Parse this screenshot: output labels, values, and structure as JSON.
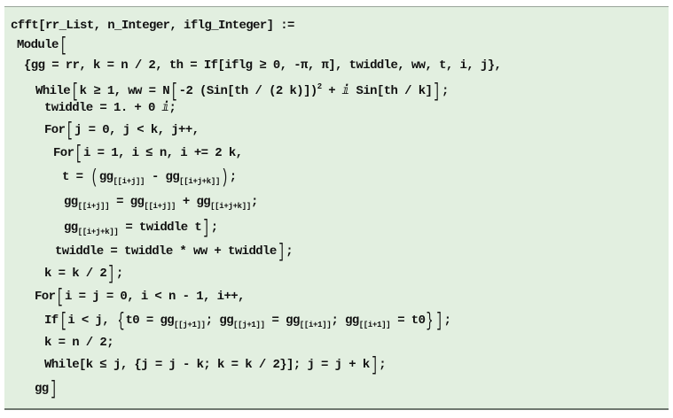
{
  "cell": {
    "background": "#e2efe0",
    "lines": [
      {
        "indent": 12,
        "segs": [
          {
            "t": "cfft[rr_List, n_Integer, iflg_Integer] :="
          }
        ]
      },
      {
        "indent": 19,
        "segs": [
          {
            "t": "Module"
          },
          {
            "t": "[",
            "k": "bb"
          }
        ]
      },
      {
        "indent": 27,
        "segs": [
          {
            "t": "{gg = rr, k = n / 2, th = If[iflg ≥ 0, -π, π], twiddle, ww, t, i, j},"
          }
        ]
      },
      {
        "indent": 40,
        "segs": [
          {
            "t": "While"
          },
          {
            "t": "[",
            "k": "bb"
          },
          {
            "t": "k ≥ 1, ww = N"
          },
          {
            "t": "[",
            "k": "bb"
          },
          {
            "t": "-2 (Sin[th / (2 k)])"
          },
          {
            "t": "2",
            "k": "sup"
          },
          {
            "t": " + ⅈ Sin[th / k]"
          },
          {
            "t": "]",
            "k": "bb"
          },
          {
            "t": ";"
          }
        ]
      },
      {
        "indent": 50,
        "segs": [
          {
            "t": "twiddle = 1. + 0 ⅈ;"
          }
        ]
      },
      {
        "indent": 50,
        "segs": [
          {
            "t": "For"
          },
          {
            "t": "[",
            "k": "bb"
          },
          {
            "t": "j = 0, j < k, j++,"
          }
        ]
      },
      {
        "indent": 60,
        "segs": [
          {
            "t": "For"
          },
          {
            "t": "[",
            "k": "bb"
          },
          {
            "t": "i = 1, i ≤ n, i += 2 k,"
          }
        ]
      },
      {
        "indent": 70,
        "segs": [
          {
            "t": "t = "
          },
          {
            "t": "(",
            "k": "bb"
          },
          {
            "t": "gg"
          },
          {
            "t": "[[i+j]]",
            "k": "sub"
          },
          {
            "t": " - gg"
          },
          {
            "t": "[[i+j+k]]",
            "k": "sub"
          },
          {
            "t": ")",
            "k": "bb"
          },
          {
            "t": ";"
          }
        ]
      },
      {
        "indent": 72,
        "segs": [
          {
            "t": "gg"
          },
          {
            "t": "[[i+j]]",
            "k": "sub"
          },
          {
            "t": " = gg"
          },
          {
            "t": "[[i+j]]",
            "k": "sub"
          },
          {
            "t": " + gg"
          },
          {
            "t": "[[i+j+k]]",
            "k": "sub"
          },
          {
            "t": ";"
          }
        ]
      },
      {
        "indent": 72,
        "segs": [
          {
            "t": "gg"
          },
          {
            "t": "[[i+j+k]]",
            "k": "sub"
          },
          {
            "t": " = twiddle t"
          },
          {
            "t": "]",
            "k": "bb"
          },
          {
            "t": ";"
          }
        ]
      },
      {
        "indent": 62,
        "segs": [
          {
            "t": "twiddle = twiddle * ww + twiddle"
          },
          {
            "t": "]",
            "k": "bb"
          },
          {
            "t": ";"
          }
        ]
      },
      {
        "indent": 50,
        "segs": [
          {
            "t": "k = k / 2"
          },
          {
            "t": "]",
            "k": "bb"
          },
          {
            "t": ";"
          }
        ]
      },
      {
        "indent": 39,
        "segs": [
          {
            "t": "For"
          },
          {
            "t": "[",
            "k": "bb"
          },
          {
            "t": "i = j = 0, i < n - 1, i++,"
          }
        ]
      },
      {
        "indent": 50,
        "segs": [
          {
            "t": "If"
          },
          {
            "t": "[",
            "k": "bb"
          },
          {
            "t": "i < j, "
          },
          {
            "t": "{",
            "k": "bb"
          },
          {
            "t": "t0 = gg"
          },
          {
            "t": "[[j+1]]",
            "k": "sub"
          },
          {
            "t": "; gg"
          },
          {
            "t": "[[j+1]]",
            "k": "sub"
          },
          {
            "t": " = gg"
          },
          {
            "t": "[[i+1]]",
            "k": "sub"
          },
          {
            "t": "; gg"
          },
          {
            "t": "[[i+1]]",
            "k": "sub"
          },
          {
            "t": " = t0"
          },
          {
            "t": "}",
            "k": "bb"
          },
          {
            "t": "]",
            "k": "bb"
          },
          {
            "t": ";"
          }
        ]
      },
      {
        "indent": 50,
        "segs": [
          {
            "t": "k = n / 2;"
          }
        ]
      },
      {
        "indent": 50,
        "segs": [
          {
            "t": "While[k ≤ j, {j = j - k; k = k / 2}]; j = j + k"
          },
          {
            "t": "]",
            "k": "bb"
          },
          {
            "t": ";"
          }
        ]
      },
      {
        "indent": 39,
        "segs": [
          {
            "t": "gg"
          },
          {
            "t": "]",
            "k": "bb"
          }
        ]
      }
    ]
  }
}
